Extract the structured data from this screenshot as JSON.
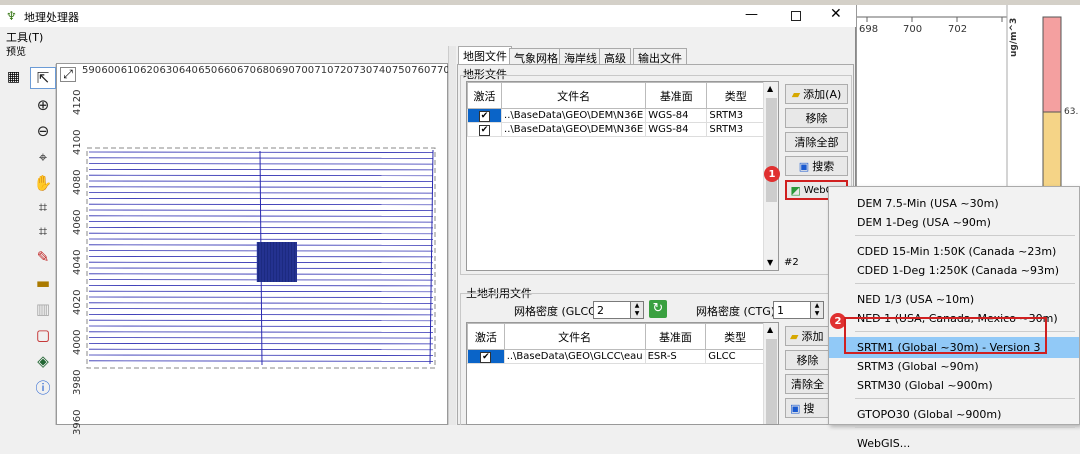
{
  "window": {
    "title": "地理处理器",
    "menu": "工具(T)",
    "preview_label": "预览"
  },
  "map": {
    "x_ticks": [
      "590",
      "600",
      "610",
      "620",
      "630",
      "640",
      "650",
      "660",
      "670",
      "680",
      "690",
      "700",
      "710",
      "720",
      "730",
      "740",
      "750",
      "760",
      "770"
    ],
    "y_ticks": [
      "4120",
      "4100",
      "4080",
      "4060",
      "4040",
      "4020",
      "4000",
      "3980",
      "3960"
    ]
  },
  "tabs": [
    "地图文件",
    "气象网格",
    "海岸线",
    "高级",
    "输出文件"
  ],
  "terrain": {
    "group_label": "地形文件",
    "columns": [
      "激活",
      "文件名",
      "基准面",
      "类型"
    ],
    "rows": [
      {
        "checked": "✔",
        "file": "..\\BaseData\\GEO\\DEM\\N36E",
        "datum": "WGS-84",
        "type": "SRTM3"
      },
      {
        "checked": "✔",
        "file": "..\\BaseData\\GEO\\DEM\\N36E",
        "datum": "WGS-84",
        "type": "SRTM3"
      }
    ],
    "buttons": {
      "add": "添加(A)",
      "remove": "移除",
      "clear": "清除全部",
      "search": "搜索",
      "webgis": "WebGIS"
    },
    "count_label": "#2"
  },
  "landuse": {
    "group_label": "土地利用文件",
    "grid_density_glcc_label": "网格密度 (GLCC):",
    "grid_density_glcc_value": "2",
    "grid_density_ctg_label": "网格密度 (CTG):",
    "grid_density_ctg_value": "1",
    "columns": [
      "激活",
      "文件名",
      "基准面",
      "类型"
    ],
    "rows": [
      {
        "checked": "✔",
        "file": "..\\BaseData\\GEO\\GLCC\\eau",
        "datum": "ESR-S",
        "type": "GLCC"
      }
    ],
    "buttons": {
      "add": "添加",
      "remove": "移除",
      "clear": "清除全",
      "search": "搜"
    }
  },
  "badges": {
    "one": "1",
    "two": "2"
  },
  "dropdown": {
    "groups": [
      [
        "DEM 7.5-Min (USA ~30m)",
        "DEM 1-Deg (USA ~90m)"
      ],
      [
        "CDED 15-Min 1:50K (Canada ~23m)",
        "CDED 1-Deg 1:250K (Canada ~93m)"
      ],
      [
        "NED 1/3 (USA ~10m)",
        "NED 1 (USA, Canada, Mexico ~30m)"
      ],
      [
        "SRTM1 (Global ~30m) - Version 3",
        "SRTM3 (Global ~90m)",
        "SRTM30 (Global ~900m)"
      ],
      [
        "GTOPO30 (Global ~900m)"
      ],
      [
        "WebGIS..."
      ]
    ]
  },
  "background_app": {
    "x_ticks": [
      "698",
      "700",
      "702"
    ],
    "units": "ug/m^3",
    "legend_value": "63.",
    "legend_colors": [
      "#f4a0a0",
      "#f5d487"
    ]
  }
}
